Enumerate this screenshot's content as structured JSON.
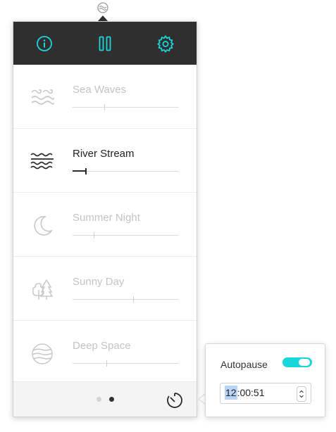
{
  "toolbar": {
    "info_icon": "info-icon",
    "pause_icon": "pause-icon",
    "settings_icon": "gear-icon",
    "accent_color": "#18d6dc"
  },
  "sounds": [
    {
      "name": "Sea Waves",
      "icon": "sea-waves-icon",
      "volume": 0.3,
      "active": false
    },
    {
      "name": "River Stream",
      "icon": "river-stream-icon",
      "volume": 0.12,
      "active": true
    },
    {
      "name": "Summer Night",
      "icon": "moon-icon",
      "volume": 0.2,
      "active": false
    },
    {
      "name": "Sunny Day",
      "icon": "trees-icon",
      "volume": 0.57,
      "active": false
    },
    {
      "name": "Deep Space",
      "icon": "planet-icon",
      "volume": 0.32,
      "active": false
    }
  ],
  "footer": {
    "pages": 2,
    "current_page": 2,
    "timer_icon": "timer-icon"
  },
  "autopause": {
    "label": "Autopause",
    "enabled": true,
    "time_hours": "12",
    "time_rest": ":00:51"
  }
}
